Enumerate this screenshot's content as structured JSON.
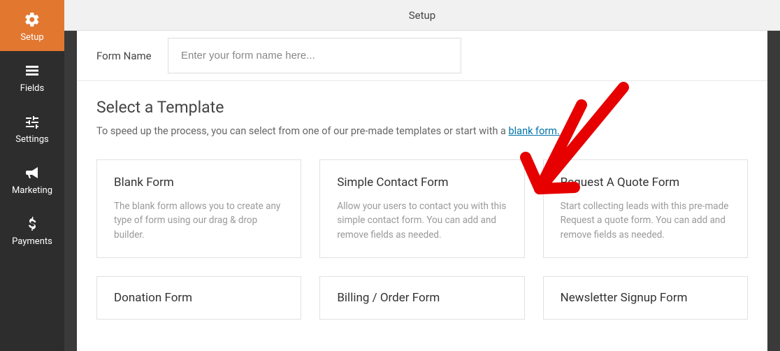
{
  "sidebar": {
    "items": [
      {
        "label": "Setup"
      },
      {
        "label": "Fields"
      },
      {
        "label": "Settings"
      },
      {
        "label": "Marketing"
      },
      {
        "label": "Payments"
      }
    ]
  },
  "topbar": {
    "title": "Setup"
  },
  "form_name": {
    "label": "Form Name",
    "placeholder": "Enter your form name here..."
  },
  "template_section": {
    "title": "Select a Template",
    "desc_prefix": "To speed up the process, you can select from one of our pre-made templates or start with a ",
    "link_text": "blank form.",
    "templates": [
      {
        "title": "Blank Form",
        "desc": "The blank form allows you to create any type of form using our drag & drop builder."
      },
      {
        "title": "Simple Contact Form",
        "desc": "Allow your users to contact you with this simple contact form. You can add and remove fields as needed."
      },
      {
        "title": "Request A Quote Form",
        "desc": "Start collecting leads with this pre-made Request a quote form. You can add and remove fields as needed."
      },
      {
        "title": "Donation Form",
        "desc": ""
      },
      {
        "title": "Billing / Order Form",
        "desc": ""
      },
      {
        "title": "Newsletter Signup Form",
        "desc": ""
      }
    ]
  }
}
